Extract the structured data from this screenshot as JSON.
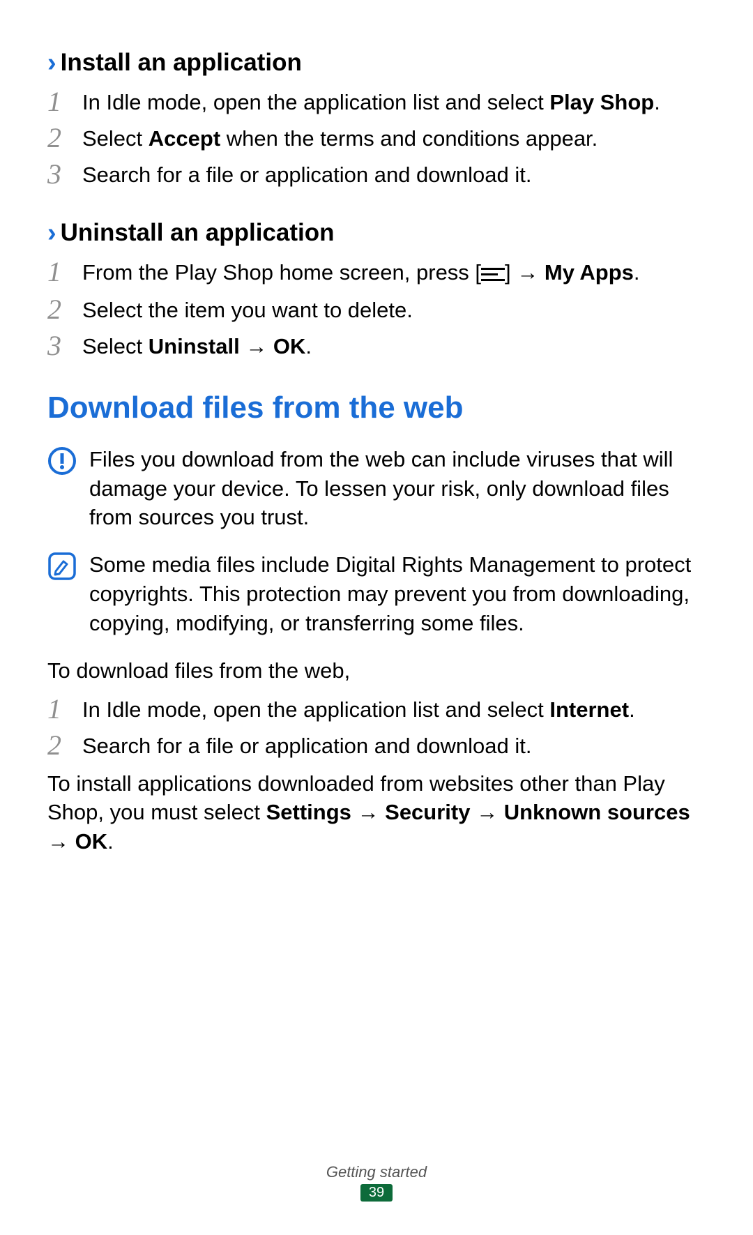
{
  "sections": {
    "install": {
      "heading": "Install an application",
      "steps": {
        "s1_a": "In Idle mode, open the application list and select ",
        "s1_b": "Play Shop",
        "s1_c": ".",
        "s2_a": "Select ",
        "s2_b": "Accept",
        "s2_c": " when the terms and conditions appear.",
        "s3": "Search for a file or application and download it."
      }
    },
    "uninstall": {
      "heading": "Uninstall an application",
      "steps": {
        "s1_a": "From the Play Shop home screen, press [",
        "s1_b": "] → ",
        "s1_c": "My Apps",
        "s1_d": ".",
        "s2": "Select the item you want to delete.",
        "s3_a": "Select ",
        "s3_b": "Uninstall",
        "s3_c": " → ",
        "s3_d": "OK",
        "s3_e": "."
      }
    },
    "download": {
      "heading": "Download files from the web",
      "warning": "Files you download from the web can include viruses that will damage your device. To lessen your risk, only download files from sources you trust.",
      "note": "Some media files include Digital Rights Management to protect copyrights. This protection may prevent you from downloading, copying, modifying, or transferring some files.",
      "intro": "To download files from the web,",
      "steps": {
        "s1_a": "In Idle mode, open the application list and select ",
        "s1_b": "Internet",
        "s1_c": ".",
        "s2": "Search for a file or application and download it."
      },
      "trail_a": "To install applications downloaded from websites other than Play Shop, you must select ",
      "trail_b": "Settings",
      "trail_c": " → ",
      "trail_d": "Security",
      "trail_e": " → ",
      "trail_f": "Unknown sources",
      "trail_g": " → ",
      "trail_h": "OK",
      "trail_i": "."
    }
  },
  "numbers": {
    "n1": "1",
    "n2": "2",
    "n3": "3"
  },
  "footer": {
    "section": "Getting started",
    "page": "39"
  }
}
